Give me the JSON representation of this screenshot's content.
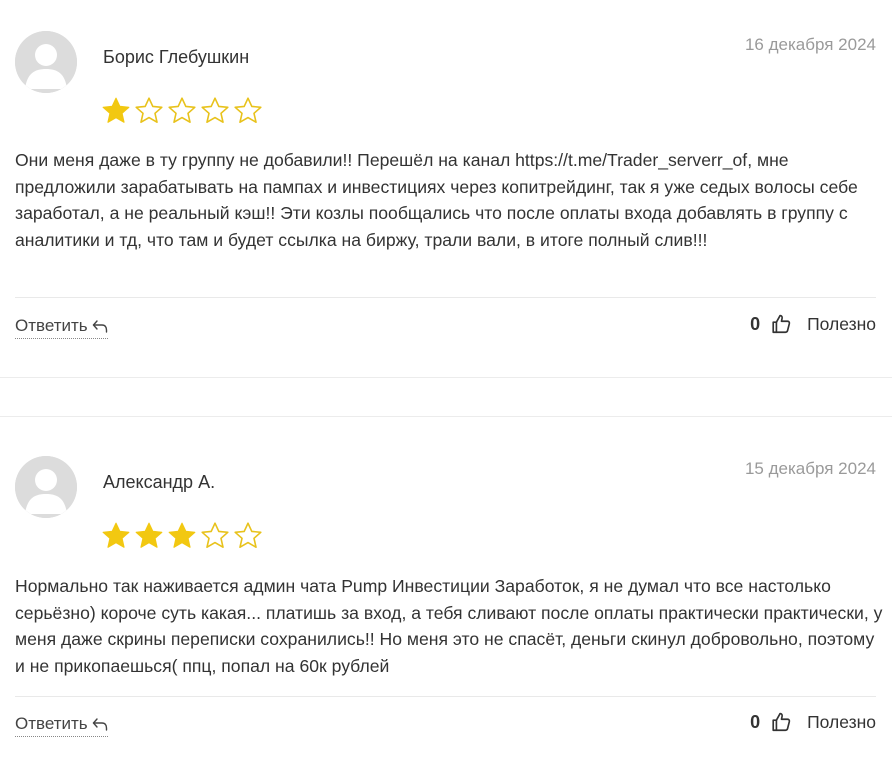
{
  "reviews": [
    {
      "author": "Борис Глебушкин",
      "date": "16 декабря 2024",
      "rating": 1,
      "max_rating": 5,
      "text": "Они меня даже в ту группу не добавили!! Перешёл на канал https://t.me/Trader_serverr_of, мне предложили зарабатывать на пампах и инвестициях через копитрейдинг, так я уже седых волосы себе заработал, а не реальный кэш!! Эти козлы пообщались что после оплаты входа добавлять в группу с аналитики и тд, что там и будет ссылка на биржу, трали вали, в итоге полный слив!!!",
      "reply_label": "Ответить",
      "useful_count": "0",
      "useful_label": "Полезно"
    },
    {
      "author": "Александр А.",
      "date": "15 декабря 2024",
      "rating": 3,
      "max_rating": 5,
      "text": "Нормально так наживается админ чата Pump Инвестиции Заработок, я не думал что все настолько серьёзно) короче суть какая... платишь за вход, а тебя сливают после оплаты практически практически, у меня даже скрины переписки сохранились!! Но меня это не спасёт, деньги скинул добровольно, поэтому и не прикопаешься( ппц, попал на 60к рублей",
      "reply_label": "Ответить",
      "useful_count": "0",
      "useful_label": "Полезно"
    }
  ],
  "colors": {
    "star_filled": "#f2c811",
    "star_outline": "#e8c21b",
    "avatar_bg": "#dcdcdc",
    "avatar_fg": "#ffffff",
    "date_text": "#9a9a9a"
  }
}
